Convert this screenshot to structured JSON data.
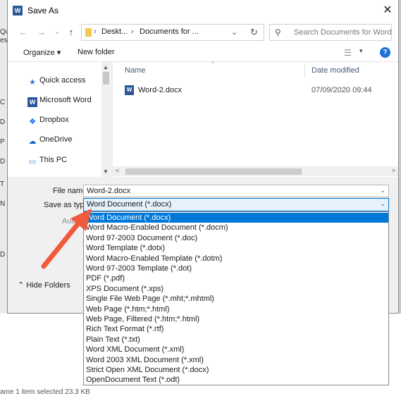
{
  "background": {
    "left_fragments": [
      "Qu",
      "ess",
      "C",
      "D",
      "P",
      "D",
      "T",
      "N",
      "D"
    ],
    "status_bar": "ame     1 item selected  23.3 KB"
  },
  "dialog": {
    "title": "Save As",
    "close_glyph": "✕",
    "app_icon_letter": "W",
    "nav": {
      "back_glyph": "←",
      "forward_glyph": "→",
      "recent_glyph": "⌄",
      "up_glyph": "↑",
      "breadcrumb": [
        "Deskt...",
        "Documents for ..."
      ],
      "breadcrumb_sep": "›",
      "dropdown_glyph": "⌄",
      "refresh_glyph": "↻",
      "search_placeholder": "Search Documents for Word",
      "search_glyph": "⚲"
    },
    "toolbar": {
      "organize_label": "Organize ▾",
      "new_folder_label": "New folder",
      "view_glyph": "☰",
      "view_chevron": "▾",
      "help_glyph": "?"
    },
    "nav_pane": {
      "items": [
        {
          "label": "Quick access",
          "icon": "star-icon",
          "glyph": "★",
          "color": "#2b7bd8"
        },
        {
          "label": "Microsoft Word",
          "icon": "word-icon",
          "glyph": "W",
          "color": "#2b579a"
        },
        {
          "label": "Dropbox",
          "icon": "dropbox-icon",
          "glyph": "❖",
          "color": "#0061fe"
        },
        {
          "label": "OneDrive",
          "icon": "cloud-icon",
          "glyph": "☁",
          "color": "#0a64c8"
        },
        {
          "label": "This PC",
          "icon": "computer-icon",
          "glyph": "▭",
          "color": "#3d7bc7"
        }
      ]
    },
    "file_pane": {
      "columns": {
        "name": "Name",
        "date_modified": "Date modified"
      },
      "files": [
        {
          "name": "Word-2.docx",
          "date_modified": "07/09/2020 09:44",
          "icon": "word-doc-icon"
        }
      ]
    },
    "fields": {
      "file_name_label": "File name:",
      "file_name_value": "Word-2.docx",
      "save_type_label": "Save as type:",
      "save_type_value": "Word Document (*.docx)",
      "authors_label": "Authors:"
    },
    "hide_folders_label": "Hide Folders",
    "save_type_options": [
      "Word Document (*.docx)",
      "Word Macro-Enabled Document (*.docm)",
      "Word 97-2003 Document (*.doc)",
      "Word Template (*.dotx)",
      "Word Macro-Enabled Template (*.dotm)",
      "Word 97-2003 Template (*.dot)",
      "PDF (*.pdf)",
      "XPS Document (*.xps)",
      "Single File Web Page (*.mht;*.mhtml)",
      "Web Page (*.htm;*.html)",
      "Web Page, Filtered (*.htm;*.html)",
      "Rich Text Format (*.rtf)",
      "Plain Text (*.txt)",
      "Word XML Document (*.xml)",
      "Word 2003 XML Document (*.xml)",
      "Strict Open XML Document (*.docx)",
      "OpenDocument Text (*.odt)"
    ],
    "selected_option_index": 0,
    "annotation_arrow_color": "#f05a3c"
  }
}
